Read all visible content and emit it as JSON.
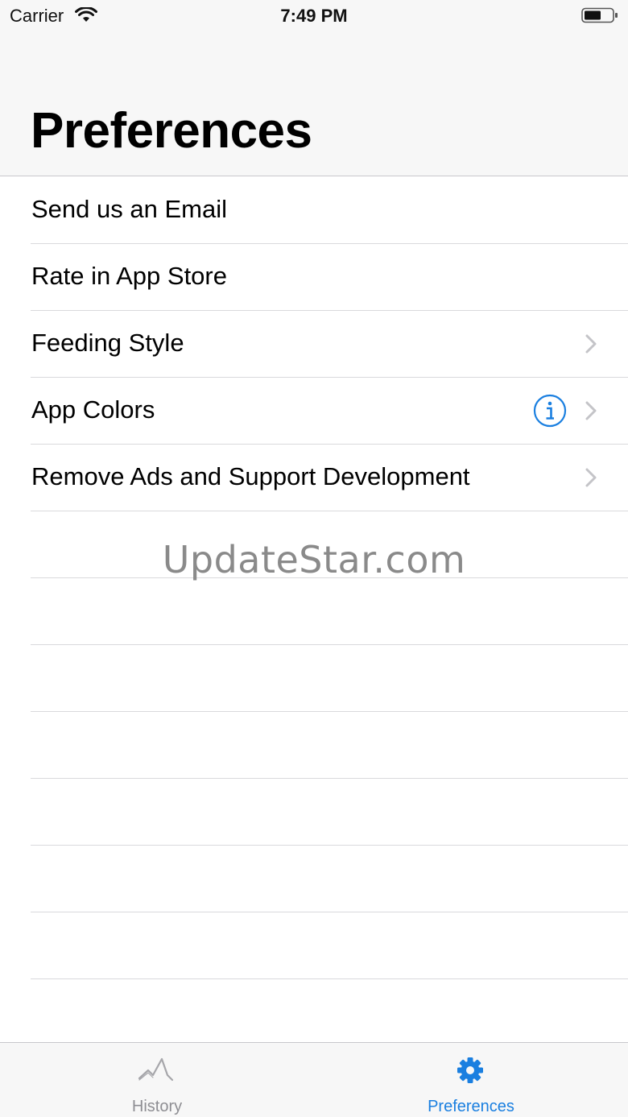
{
  "status_bar": {
    "carrier": "Carrier",
    "time": "7:49 PM",
    "wifi_icon": "wifi-icon",
    "battery_icon": "battery-icon"
  },
  "header": {
    "title": "Preferences"
  },
  "list": {
    "items": [
      {
        "label": "Send us an Email",
        "chevron": false,
        "info": false
      },
      {
        "label": "Rate in App Store",
        "chevron": false,
        "info": false
      },
      {
        "label": "Feeding Style",
        "chevron": true,
        "info": false
      },
      {
        "label": "App Colors",
        "chevron": true,
        "info": true
      },
      {
        "label": "Remove Ads and Support Development",
        "chevron": true,
        "info": false
      }
    ],
    "empty_rows": 7
  },
  "watermark": "UpdateStar.com",
  "tab_bar": {
    "tabs": [
      {
        "label": "History",
        "icon": "chart-line-icon",
        "selected": false
      },
      {
        "label": "Preferences",
        "icon": "gear-icon",
        "selected": true
      }
    ]
  },
  "colors": {
    "accent": "#1a7fe0",
    "inactive": "#8e8e93",
    "separator": "#d9d9dc",
    "bar_background": "#f7f7f7"
  }
}
